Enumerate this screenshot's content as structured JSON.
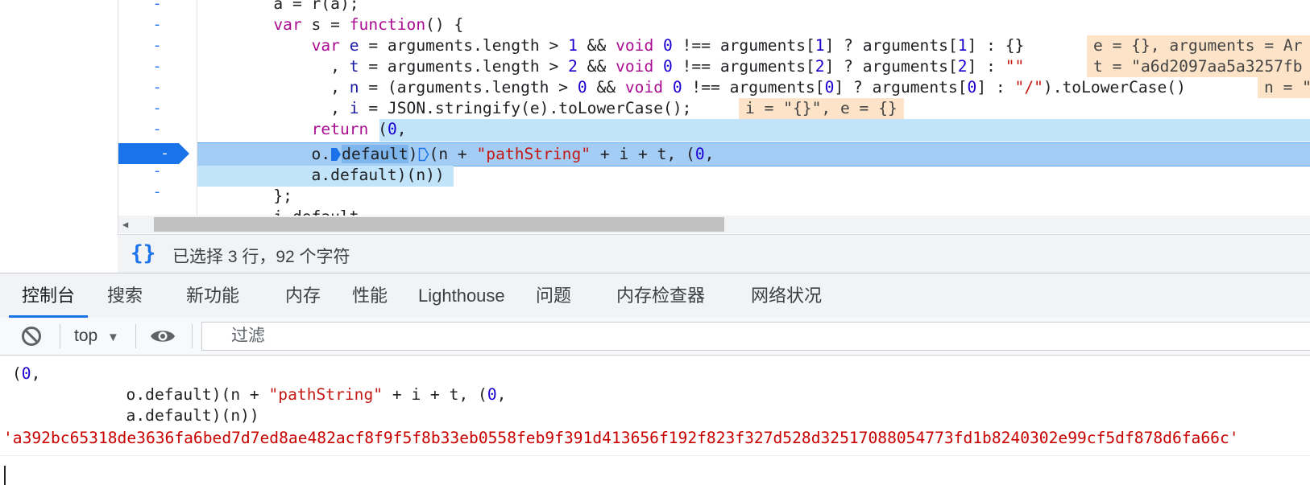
{
  "editor": {
    "gutter_marker": "-",
    "lines": [
      {
        "a": "        a = r(a);"
      },
      {
        "a": "        ",
        "kw": "var",
        "b": " s = ",
        "kw2": "function",
        "c": "() {"
      },
      {
        "a": "            ",
        "kw": "var",
        "b": " ",
        "v": "e",
        "c": " = arguments.length > ",
        "n1": "1",
        "d": " && ",
        "kw2": "void",
        "e": " ",
        "n2": "0",
        "f": " !== arguments[",
        "n3": "1",
        "g": "] ? arguments[",
        "n4": "1",
        "h": "] : {}"
      },
      {
        "a": "              , ",
        "v": "t",
        "c": " = arguments.length > ",
        "n1": "2",
        "d": " && ",
        "kw2": "void",
        "e": " ",
        "n2": "0",
        "f": " !== arguments[",
        "n3": "2",
        "g": "] ? arguments[",
        "n4": "2",
        "h": "] : ",
        "s": "\"\""
      },
      {
        "a": "              , ",
        "v": "n",
        "c": " = (arguments.length > ",
        "n1": "0",
        "d": " && ",
        "kw2": "void",
        "e": " ",
        "n2": "0",
        "f": " !== arguments[",
        "n3": "0",
        "g": "] ? arguments[",
        "n4": "0",
        "h": "] : ",
        "s": "\"/\"",
        "i": ").toLowerCase()"
      },
      {
        "a": "              , ",
        "v": "i",
        "c": " = JSON.stringify(e).toLowerCase();"
      },
      {
        "a": "            ",
        "kw": "return",
        "b": " (",
        "n1": "0",
        "c": ","
      },
      {
        "a": "            o.",
        "w": "default",
        "b": ")",
        "c": "(n + ",
        "s": "\"pathString\"",
        "d": " + i + t, (",
        "n1": "0",
        "e": ","
      },
      {
        "a": "            a.default)(n))"
      },
      {
        "a": "        };"
      },
      {
        "a": "        i.default"
      }
    ],
    "inlays": {
      "e_line": "e = {}, arguments = Ar",
      "t_line": "t = \"a6d2097aa5a3257fb",
      "n_line": "n = \"",
      "i_line": "i = \"{}\", e = {}"
    }
  },
  "statusbar": {
    "pretty_print_icon": "{}",
    "text": "已选择 3 行，92 个字符"
  },
  "drawer_tabs": [
    {
      "label": "控制台",
      "active": true
    },
    {
      "label": "搜索"
    },
    {
      "label": "新功能"
    },
    {
      "label": "内存"
    },
    {
      "label": "性能"
    },
    {
      "label": "Lighthouse"
    },
    {
      "label": "问题"
    },
    {
      "label": "内存检查器"
    },
    {
      "label": "网络状况"
    }
  ],
  "toolbar": {
    "context": "top",
    "context_arrow": "▼",
    "filter_placeholder": "过滤"
  },
  "console": {
    "echo_line1_a": "(",
    "echo_line1_num": "0",
    "echo_line1_b": ",",
    "echo_line2_a": "            o.default)(n + ",
    "echo_line2_str": "\"pathString\"",
    "echo_line2_b": " + i + t, (",
    "echo_line2_num": "0",
    "echo_line2_c": ",",
    "echo_line3": "            a.default)(n))",
    "result": "'a392bc65318de3636fa6bed7d7ed8ae482acf8f9f5f8b33eb0558feb9f391d413656f192f823f327d528d32517088054773fd1b8240302e99cf5df878d6fa66c'"
  },
  "colors": {
    "accent": "#1a73e8",
    "keyword": "#aa0d91",
    "number": "#1c00cf",
    "string": "#c41a16",
    "result": "#c80000",
    "inlay_bg": "#fde4c8",
    "selection": "#c2e4fb"
  }
}
